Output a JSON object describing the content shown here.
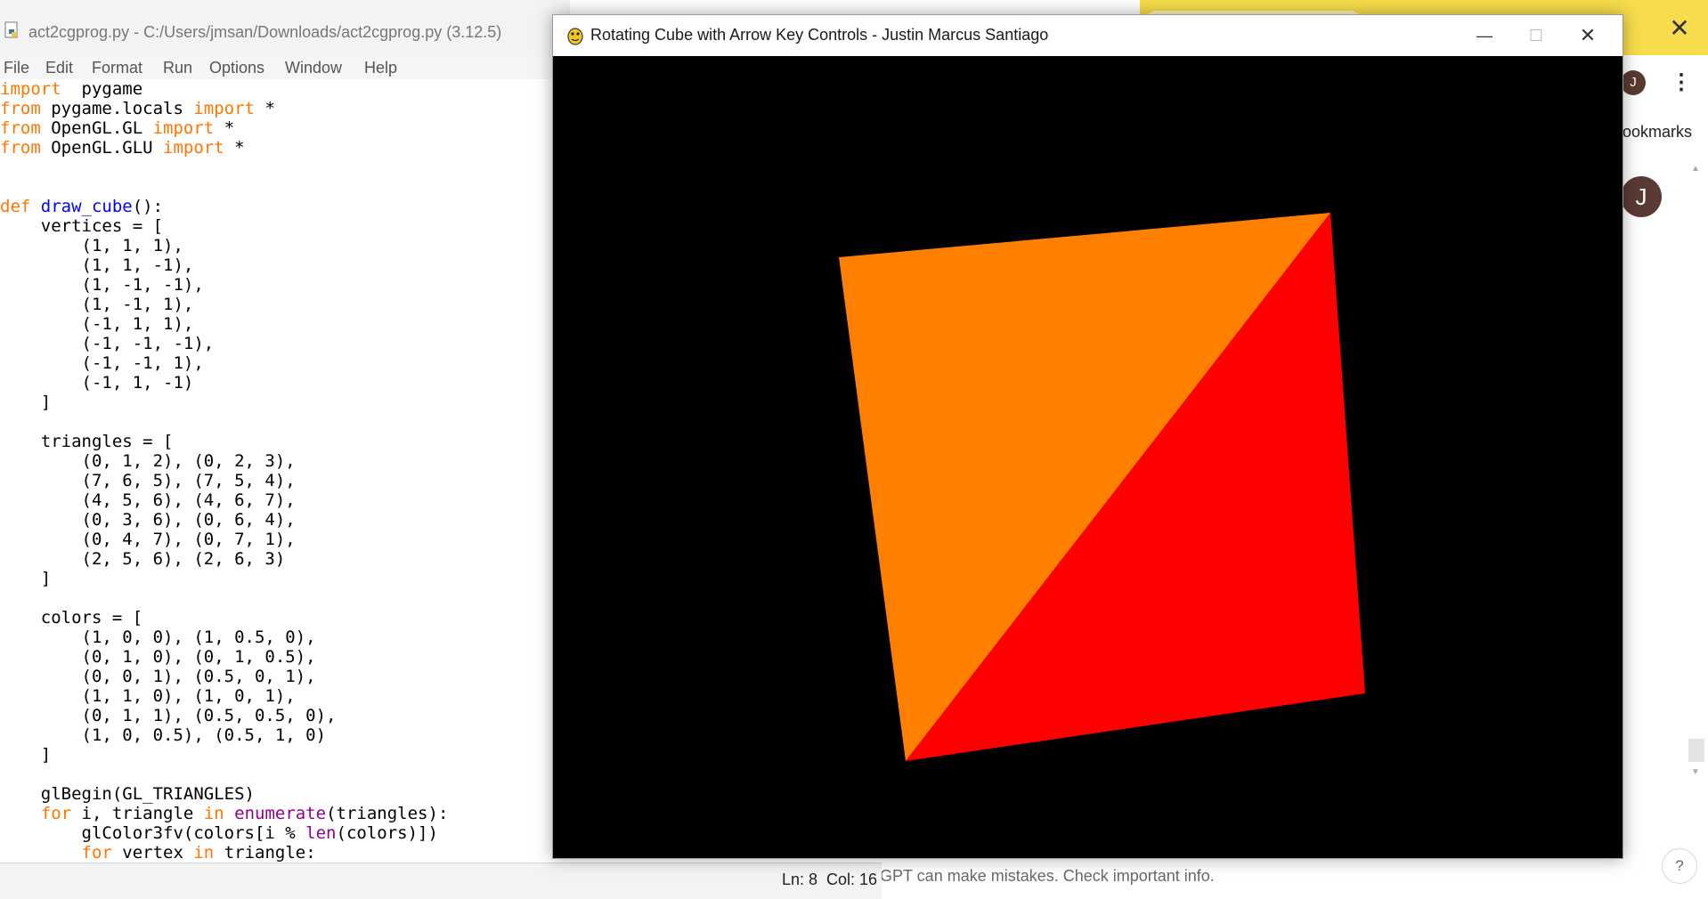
{
  "browser": {
    "avatar_letter": "J",
    "bookmarks_label": "ookmarks",
    "chat_avatar_letter": "J",
    "disclaimer": "GPT can make mistakes. Check important info.",
    "help_label": "?",
    "close_glyph": "✕",
    "menu_glyph": "⋮"
  },
  "idle": {
    "title": "act2cgprog.py - C:/Users/jmsan/Downloads/act2cgprog.py (3.12.5)",
    "menus": [
      "File",
      "Edit",
      "Format",
      "Run",
      "Options",
      "Window",
      "Help"
    ],
    "status": {
      "ln": "Ln: 8",
      "col": "Col: 16"
    }
  },
  "pygame": {
    "title": "Rotating Cube with Arrow Key Controls - Justin Marcus Santiago",
    "controls": {
      "minimize": "—",
      "maximize": "☐",
      "close": "✕"
    },
    "faces": [
      {
        "name": "orange-triangle",
        "color": "#ff8000"
      },
      {
        "name": "red-triangle",
        "color": "#ff0000"
      }
    ]
  },
  "code_lines": [
    [
      [
        "kw",
        "import"
      ],
      [
        "",
        "  pygame"
      ]
    ],
    [
      [
        "kw",
        "from"
      ],
      [
        "",
        " pygame.locals "
      ],
      [
        "kw",
        "import"
      ],
      [
        "",
        " *"
      ]
    ],
    [
      [
        "kw",
        "from"
      ],
      [
        "",
        " OpenGL.GL "
      ],
      [
        "kw",
        "import"
      ],
      [
        "",
        " *"
      ]
    ],
    [
      [
        "kw",
        "from"
      ],
      [
        "",
        " OpenGL.GLU "
      ],
      [
        "kw",
        "import"
      ],
      [
        "",
        " *"
      ]
    ],
    [
      [
        "",
        ""
      ]
    ],
    [
      [
        "",
        ""
      ]
    ],
    [
      [
        "kw",
        "def"
      ],
      [
        "",
        " "
      ],
      [
        "fn",
        "draw_cube"
      ],
      [
        "",
        "():"
      ]
    ],
    [
      [
        "",
        "    vertices = ["
      ]
    ],
    [
      [
        "",
        "        (1, 1, 1),"
      ]
    ],
    [
      [
        "",
        "        (1, 1, -1),"
      ]
    ],
    [
      [
        "",
        "        (1, -1, -1),"
      ]
    ],
    [
      [
        "",
        "        (1, -1, 1),"
      ]
    ],
    [
      [
        "",
        "        (-1, 1, 1),"
      ]
    ],
    [
      [
        "",
        "        (-1, -1, -1),"
      ]
    ],
    [
      [
        "",
        "        (-1, -1, 1),"
      ]
    ],
    [
      [
        "",
        "        (-1, 1, -1)"
      ]
    ],
    [
      [
        "",
        "    ]"
      ]
    ],
    [
      [
        "",
        ""
      ]
    ],
    [
      [
        "",
        "    triangles = ["
      ]
    ],
    [
      [
        "",
        "        (0, 1, 2), (0, 2, 3),"
      ]
    ],
    [
      [
        "",
        "        (7, 6, 5), (7, 5, 4),"
      ]
    ],
    [
      [
        "",
        "        (4, 5, 6), (4, 6, 7),"
      ]
    ],
    [
      [
        "",
        "        (0, 3, 6), (0, 6, 4),"
      ]
    ],
    [
      [
        "",
        "        (0, 4, 7), (0, 7, 1),"
      ]
    ],
    [
      [
        "",
        "        (2, 5, 6), (2, 6, 3)"
      ]
    ],
    [
      [
        "",
        "    ]"
      ]
    ],
    [
      [
        "",
        ""
      ]
    ],
    [
      [
        "",
        "    colors = ["
      ]
    ],
    [
      [
        "",
        "        (1, 0, 0), (1, 0.5, 0),"
      ]
    ],
    [
      [
        "",
        "        (0, 1, 0), (0, 1, 0.5),"
      ]
    ],
    [
      [
        "",
        "        (0, 0, 1), (0.5, 0, 1),"
      ]
    ],
    [
      [
        "",
        "        (1, 1, 0), (1, 0, 1),"
      ]
    ],
    [
      [
        "",
        "        (0, 1, 1), (0.5, 0.5, 0),"
      ]
    ],
    [
      [
        "",
        "        (1, 0, 0.5), (0.5, 1, 0)"
      ]
    ],
    [
      [
        "",
        "    ]"
      ]
    ],
    [
      [
        "",
        ""
      ]
    ],
    [
      [
        "",
        "    glBegin(GL_TRIANGLES)"
      ]
    ],
    [
      [
        "",
        "    "
      ],
      [
        "kw",
        "for"
      ],
      [
        "",
        " i, triangle "
      ],
      [
        "kw",
        "in"
      ],
      [
        "",
        " "
      ],
      [
        "bi",
        "enumerate"
      ],
      [
        "",
        "(triangles):"
      ]
    ],
    [
      [
        "",
        "        glColor3fv(colors[i % "
      ],
      [
        "bi",
        "len"
      ],
      [
        "",
        "(colors)])"
      ]
    ],
    [
      [
        "",
        "        "
      ],
      [
        "kw",
        "for"
      ],
      [
        "",
        " vertex "
      ],
      [
        "kw",
        "in"
      ],
      [
        "",
        " triangle:"
      ]
    ]
  ]
}
